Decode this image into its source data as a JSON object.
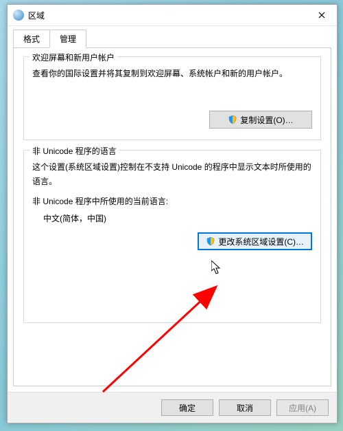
{
  "title": "区域",
  "tabs": {
    "format": "格式",
    "admin": "管理"
  },
  "group1": {
    "title": "欢迎屏幕和新用户帐户",
    "desc": "查看你的国际设置并将其复制到欢迎屏幕、系统帐户和新的用户帐户。",
    "button": "复制设置(O)…"
  },
  "group2": {
    "title": "非 Unicode 程序的语言",
    "desc": "这个设置(系统区域设置)控制在不支持 Unicode 的程序中显示文本时所使用的语言。",
    "current_label": "非 Unicode 程序中所使用的当前语言:",
    "current_value": "中文(简体，中国)",
    "button": "更改系统区域设置(C)…"
  },
  "buttons": {
    "ok": "确定",
    "cancel": "取消",
    "apply": "应用(A)"
  }
}
